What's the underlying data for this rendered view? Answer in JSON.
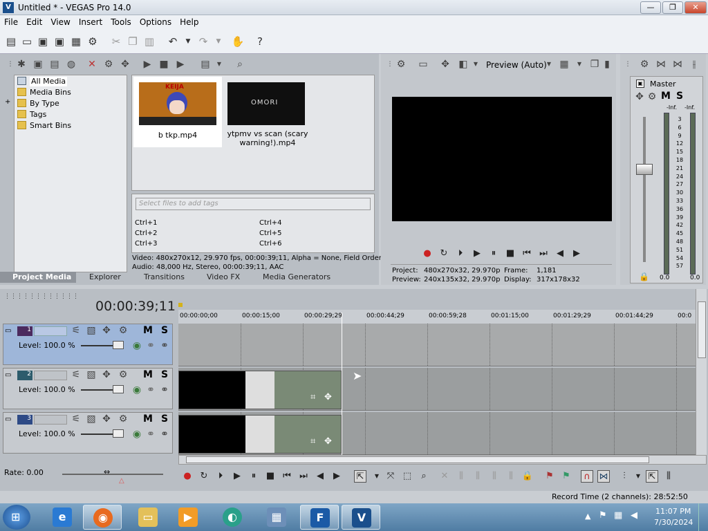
{
  "window": {
    "title": "Untitled * - VEGAS Pro 14.0",
    "logo": "V",
    "minimize": "—",
    "maximize": "❐",
    "close": "✕"
  },
  "menu": [
    "File",
    "Edit",
    "View",
    "Insert",
    "Tools",
    "Options",
    "Help"
  ],
  "toolbar": {
    "icons": [
      "new-icon",
      "open-icon",
      "save-icon",
      "save-as-icon",
      "properties-icon",
      "cut-icon",
      "copy-icon",
      "paste-icon",
      "undo-icon",
      "redo-icon",
      "render-icon",
      "help-icon"
    ]
  },
  "project_media": {
    "tree": [
      {
        "label": "All Media",
        "selected": true
      },
      {
        "label": "Media Bins"
      },
      {
        "label": "By Type",
        "expand": "+"
      },
      {
        "label": "Tags"
      },
      {
        "label": "Smart Bins"
      }
    ],
    "files": [
      {
        "name": "b tkp.mp4",
        "thumb_text": "KEIJA"
      },
      {
        "name": "ytpmv vs scan (scary warning!).mp4",
        "thumb_text": "OMORI"
      }
    ],
    "tags_placeholder": "Select files to add tags",
    "shortcuts": [
      "Ctrl+1",
      "Ctrl+2",
      "Ctrl+3",
      "Ctrl+4",
      "Ctrl+5",
      "Ctrl+6"
    ],
    "info_video": "Video: 480x270x12, 29.970 fps, 00:00:39;11, Alpha = None, Field Order",
    "info_audio": "Audio: 48,000 Hz, Stereo, 00:00:39;11, AAC"
  },
  "dock_tabs": [
    "Project Media",
    "Explorer",
    "Transitions",
    "Video FX",
    "Media Generators"
  ],
  "preview": {
    "quality": "Preview (Auto)",
    "project_label": "Project:",
    "project_value": "480x270x32, 29.970p",
    "preview_label": "Preview:",
    "preview_value": "240x135x32, 29.970p",
    "frame_label": "Frame:",
    "frame_value": "1,181",
    "display_label": "Display:",
    "display_value": "317x178x32"
  },
  "mixer": {
    "title": "Master",
    "m": "M",
    "s": "S",
    "peak_l": "-Inf.",
    "peak_r": "-Inf.",
    "scale": [
      "3",
      "6",
      "9",
      "12",
      "15",
      "18",
      "21",
      "24",
      "27",
      "30",
      "33",
      "36",
      "39",
      "42",
      "45",
      "48",
      "51",
      "54",
      "57"
    ],
    "val_l": "0.0",
    "val_r": "0.0"
  },
  "timeline": {
    "timecode": "00:00:39;11",
    "ruler": [
      "00:00:00;00",
      "00:00:15;00",
      "00:00:29;29",
      "00:00:44;29",
      "00:00:59;28",
      "00:01:15;00",
      "00:01:29;29",
      "00:01:44;29",
      "00:0"
    ],
    "tracks": [
      {
        "num": "1",
        "level": "Level: 100.0 %",
        "m": "M",
        "s": "S"
      },
      {
        "num": "2",
        "level": "Level: 100.0 %",
        "m": "M",
        "s": "S"
      },
      {
        "num": "3",
        "level": "Level: 100.0 %",
        "m": "M",
        "s": "S"
      }
    ],
    "rate": "Rate: 0.00"
  },
  "status": {
    "record_time": "Record Time (2 channels): 28:52:50"
  },
  "taskbar": {
    "time": "11:07 PM",
    "date": "7/30/2024"
  }
}
